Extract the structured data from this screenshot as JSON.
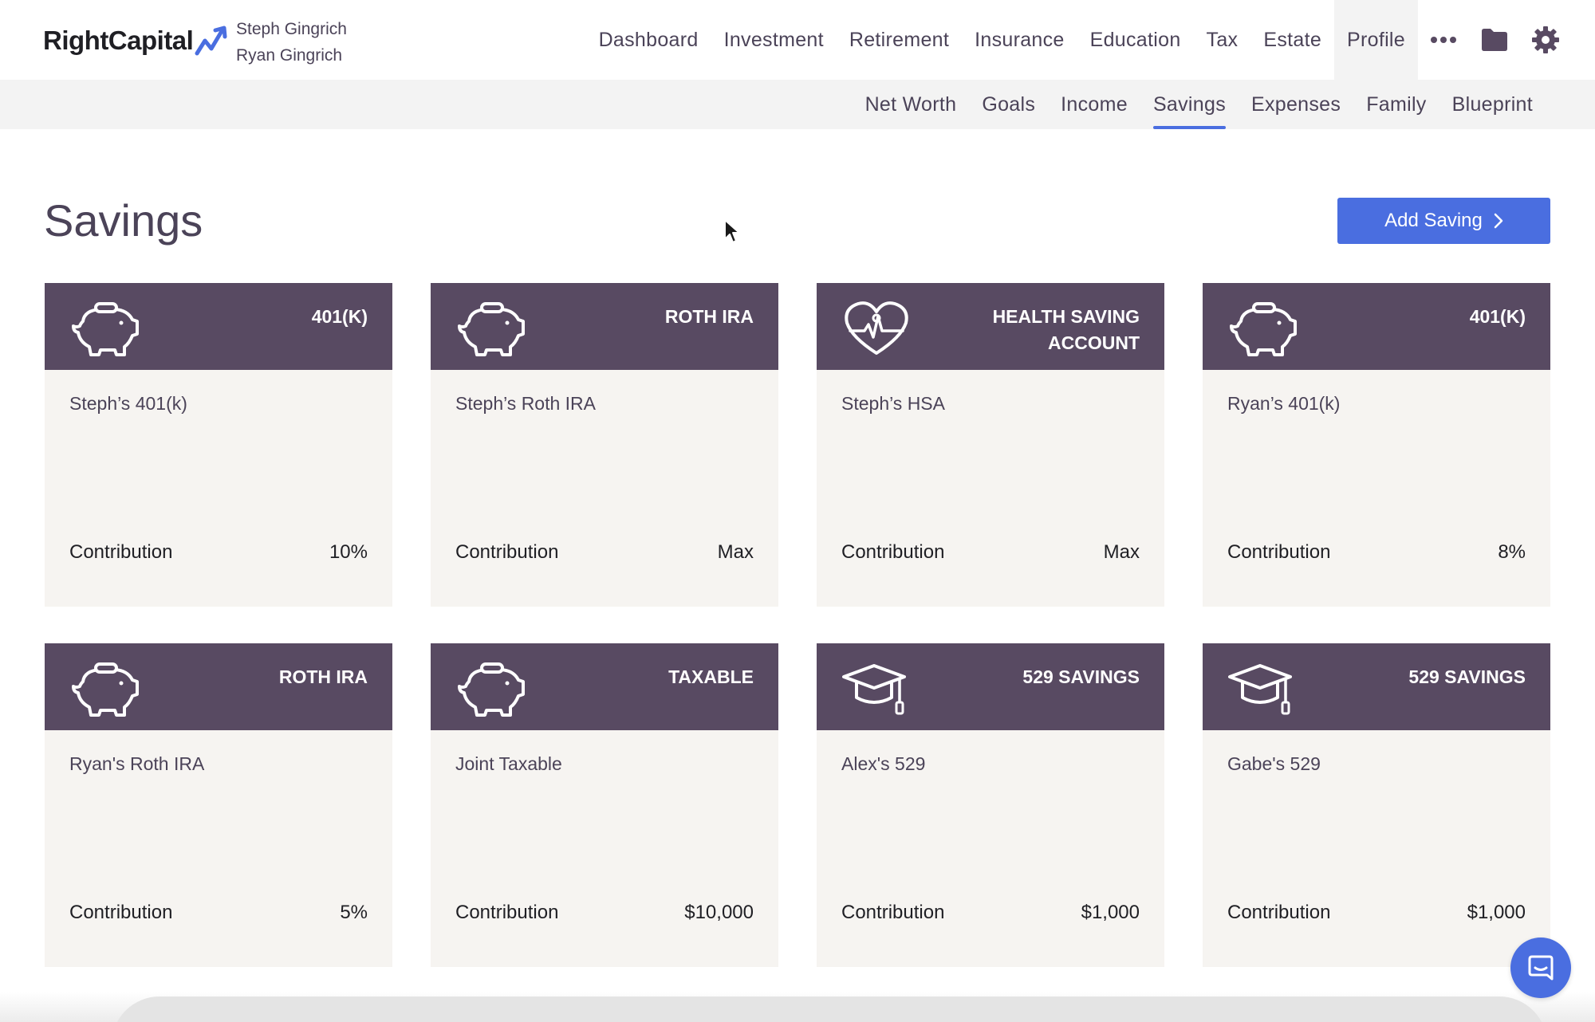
{
  "app": {
    "logo_text": "RightCapital",
    "clients": [
      "Steph Gingrich",
      "Ryan Gingrich"
    ]
  },
  "main_nav": {
    "items": [
      {
        "label": "Dashboard"
      },
      {
        "label": "Investment"
      },
      {
        "label": "Retirement"
      },
      {
        "label": "Insurance"
      },
      {
        "label": "Education"
      },
      {
        "label": "Tax"
      },
      {
        "label": "Estate"
      },
      {
        "label": "Profile",
        "active": true
      }
    ],
    "icons": [
      "more-icon",
      "folder-icon",
      "gear-icon"
    ]
  },
  "sub_nav": {
    "items": [
      {
        "label": "Net Worth"
      },
      {
        "label": "Goals"
      },
      {
        "label": "Income"
      },
      {
        "label": "Savings",
        "active": true
      },
      {
        "label": "Expenses"
      },
      {
        "label": "Family"
      },
      {
        "label": "Blueprint"
      }
    ]
  },
  "page": {
    "title": "Savings",
    "add_button": "Add Saving"
  },
  "cards": [
    {
      "type": "401(K)",
      "icon": "piggy-bank-icon",
      "name": "Steph’s 401(k)",
      "label": "Contribution",
      "value": "10%"
    },
    {
      "type": "ROTH IRA",
      "icon": "piggy-bank-icon",
      "name": "Steph’s Roth IRA",
      "label": "Contribution",
      "value": "Max"
    },
    {
      "type": "HEALTH SAVING ACCOUNT",
      "icon": "heart-pulse-icon",
      "name": "Steph’s HSA",
      "label": "Contribution",
      "value": "Max"
    },
    {
      "type": "401(K)",
      "icon": "piggy-bank-icon",
      "name": "Ryan’s 401(k)",
      "label": "Contribution",
      "value": "8%"
    },
    {
      "type": "ROTH IRA",
      "icon": "piggy-bank-icon",
      "name": "Ryan's Roth IRA",
      "label": "Contribution",
      "value": "5%"
    },
    {
      "type": "TAXABLE",
      "icon": "piggy-bank-icon",
      "name": "Joint Taxable",
      "label": "Contribution",
      "value": "$10,000"
    },
    {
      "type": "529 SAVINGS",
      "icon": "graduation-cap-icon",
      "name": "Alex's 529",
      "label": "Contribution",
      "value": "$1,000"
    },
    {
      "type": "529 SAVINGS",
      "icon": "graduation-cap-icon",
      "name": "Gabe's 529",
      "label": "Contribution",
      "value": "$1,000"
    }
  ],
  "colors": {
    "card_header": "#584a62",
    "card_body": "#f6f4f1",
    "accent": "#4a6ee0",
    "text": "#4b4358"
  }
}
